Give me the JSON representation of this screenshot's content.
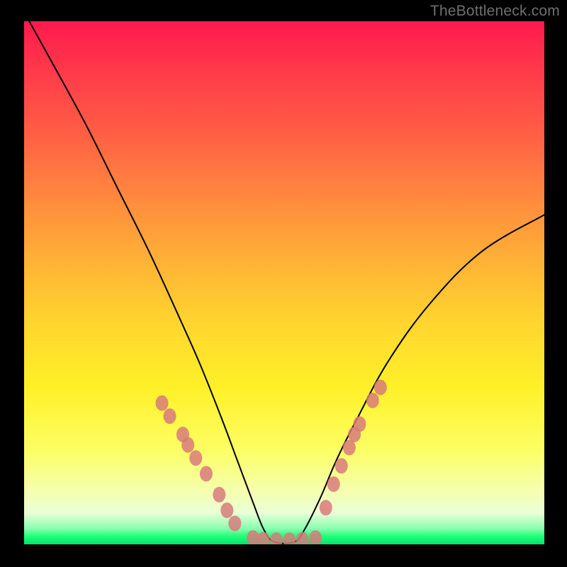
{
  "watermark": "TheBottleneck.com",
  "colors": {
    "dot": "#d87a7c",
    "curve": "#000000",
    "frame": "#000000"
  },
  "chart_data": {
    "type": "line",
    "title": "",
    "xlabel": "",
    "ylabel": "",
    "xlim": [
      0,
      100
    ],
    "ylim": [
      0,
      100
    ],
    "note": "Axes have no visible tick labels; values are normalized 0–100.",
    "curve": {
      "name": "bottleneck-curve",
      "x": [
        1,
        6,
        12,
        18,
        24,
        30,
        34,
        38,
        41,
        44,
        46,
        48,
        52,
        54,
        57,
        60,
        64,
        70,
        78,
        88,
        100
      ],
      "y": [
        100,
        91,
        80,
        68,
        56,
        43,
        34,
        24,
        16,
        8,
        3,
        0.5,
        0.5,
        3,
        9,
        16,
        24,
        35,
        46,
        56,
        63
      ]
    },
    "series": [
      {
        "name": "left-cluster-dots",
        "x": [
          26.5,
          28.0,
          30.5,
          31.5,
          33.0,
          35.0,
          37.5,
          39.0,
          40.5
        ],
        "y": [
          27.0,
          24.5,
          21.0,
          19.0,
          16.5,
          13.5,
          9.5,
          6.5,
          4.0
        ]
      },
      {
        "name": "bottom-cluster-dots",
        "x": [
          44.0,
          46.0,
          48.5,
          51.0,
          53.5,
          56.0
        ],
        "y": [
          1.2,
          0.9,
          0.8,
          0.8,
          0.9,
          1.2
        ]
      },
      {
        "name": "right-cluster-dots",
        "x": [
          58.0,
          59.5,
          61.0,
          62.5,
          63.5,
          64.5,
          67.0,
          68.5
        ],
        "y": [
          7.0,
          11.5,
          15.0,
          18.5,
          21.0,
          23.0,
          27.5,
          30.0
        ]
      }
    ]
  }
}
